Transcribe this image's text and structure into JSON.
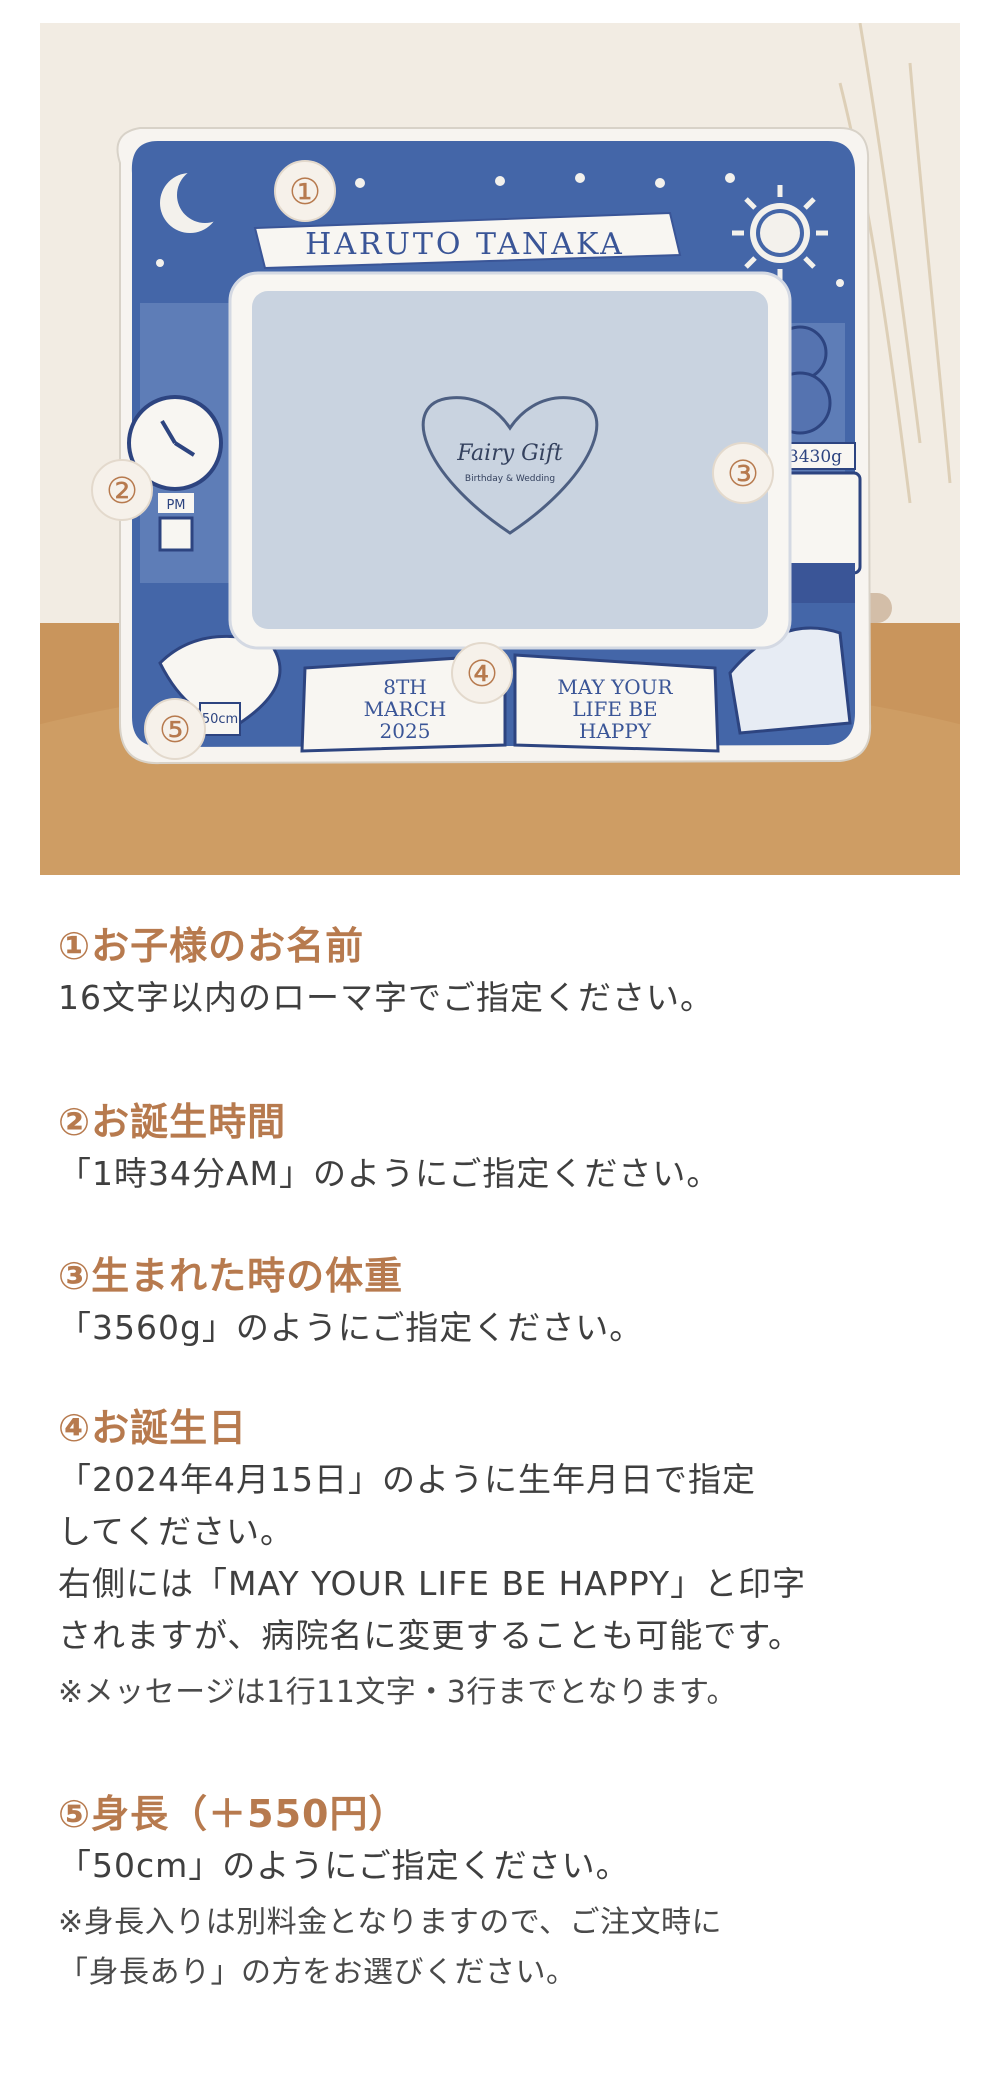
{
  "photo": {
    "banner_name": "HARUTO TANAKA",
    "center_logo": "Fairy Gift",
    "center_logo_sub": "Birthday & Wedding",
    "clock_label": "PM",
    "weight_display": "3430g",
    "book_left": [
      "8TH",
      "MARCH",
      "2025"
    ],
    "book_right": [
      "MAY YOUR",
      "LIFE BE",
      "HAPPY"
    ],
    "height_tag": "50cm",
    "markers": [
      "①",
      "②",
      "③",
      "④",
      "⑤"
    ],
    "colors": {
      "wall": "#f3eee6",
      "table": "#c8955a",
      "frame_white": "#f7f5f2",
      "frame_blue": "#3a5597",
      "photo_area": "#c9d3e0",
      "accent_brown": "#b77a4e"
    }
  },
  "sections": [
    {
      "heading": "①お子様のお名前",
      "lines": [
        "16文字以内のローマ字でご指定ください。"
      ],
      "notes": []
    },
    {
      "heading": "②お誕生時間",
      "lines": [
        "「1時34分AM」のようにご指定ください。"
      ],
      "notes": []
    },
    {
      "heading": "③生まれた時の体重",
      "lines": [
        "「3560g」のようにご指定ください。"
      ],
      "notes": []
    },
    {
      "heading": "④お誕生日",
      "lines": [
        "「2024年4月15日」のように生年月日で指定",
        "してください。",
        "右側には「MAY YOUR LIFE BE HAPPY」と印字",
        "されますが、病院名に変更することも可能です。"
      ],
      "notes": [
        "※メッセージは1行11文字・3行までとなります。"
      ]
    },
    {
      "heading": "⑤身長（＋550円）",
      "lines": [
        "「50cm」のようにご指定ください。"
      ],
      "notes": [
        "※身長入りは別料金となりますので、ご注文時に",
        "「身長あり」の方をお選びください。"
      ]
    }
  ]
}
